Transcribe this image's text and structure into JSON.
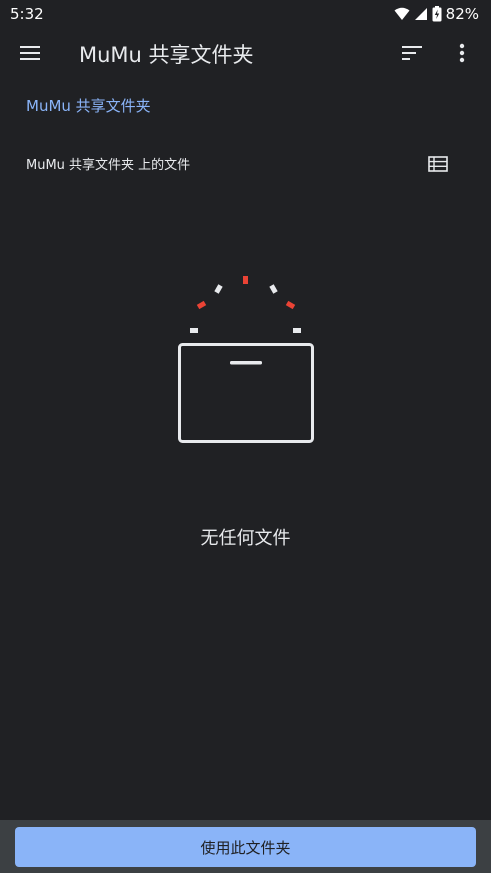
{
  "status_bar": {
    "time": "5:32",
    "battery": "82%"
  },
  "app_bar": {
    "title": "MuMu 共享文件夹",
    "menu_icon": "hamburger-menu-icon",
    "sort_icon": "sort-icon",
    "more_icon": "more-vert-icon"
  },
  "breadcrumb": {
    "label": "MuMu 共享文件夹"
  },
  "file_list": {
    "header": "MuMu 共享文件夹 上的文件",
    "view_toggle_icon": "list-view-icon",
    "empty_message": "无任何文件"
  },
  "action": {
    "button_label": "使用此文件夹"
  },
  "colors": {
    "background": "#202124",
    "accent": "#8ab4f8",
    "illustration_red": "#ea4335",
    "bottom_bar": "#3c4043"
  }
}
